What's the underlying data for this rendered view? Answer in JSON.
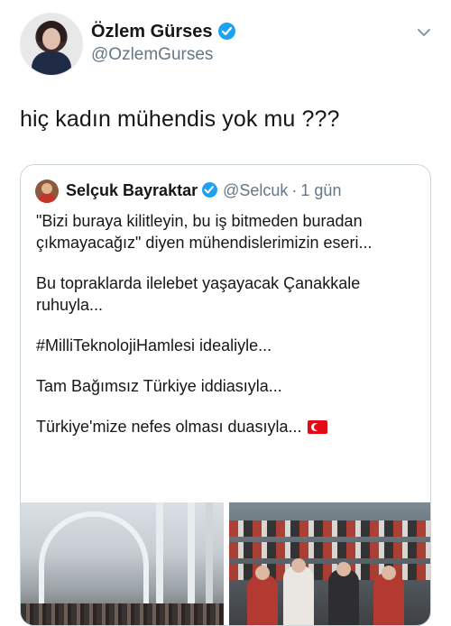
{
  "author": {
    "name": "Özlem Gürses",
    "handle": "@OzlemGurses",
    "avatar": "user-avatar",
    "verified": true
  },
  "tweet": {
    "text": "hiç kadın mühendis yok mu ???"
  },
  "quoted_tweet": {
    "author_name": "Selçuk Bayraktar",
    "handle": "@Selcuk",
    "separator": "·",
    "time": "1 gün",
    "verified": true,
    "paragraphs": [
      "\"Bizi buraya kilitleyin, bu iş bitmeden buradan çıkmayacağız\" diyen mühendislerimizin eseri...",
      "Bu topraklarda ilelebet yaşayacak Çanakkale ruhuyla...",
      "#MilliTeknolojiHamlesi idealiyle...",
      "Tam Bağımsız Türkiye iddiasıyla...",
      "Türkiye'mize nefes olması duasıyla..."
    ],
    "flag": "turkey-flag-emoji",
    "images": [
      "building-interior-photo",
      "engineers-group-photo"
    ]
  },
  "colors": {
    "verified": "#1da1f2",
    "text_primary": "#14171a",
    "text_secondary": "#657786",
    "border": "#ccd6dd"
  }
}
